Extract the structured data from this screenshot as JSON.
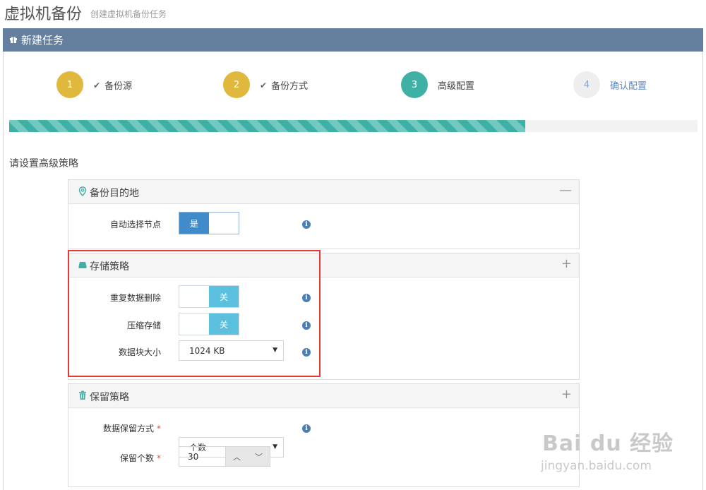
{
  "page": {
    "title": "虚拟机备份",
    "subtitle": "创建虚拟机备份任务"
  },
  "task_header": {
    "title": "新建任务",
    "icon": "gift-icon"
  },
  "steps": [
    {
      "number": "1",
      "label": "备份源",
      "done": true,
      "color": "#e0b83e"
    },
    {
      "number": "2",
      "label": "备份方式",
      "done": true,
      "color": "#e0b83e"
    },
    {
      "number": "3",
      "label": "高级配置",
      "done": false,
      "color": "#3fb0a5"
    },
    {
      "number": "4",
      "label": "确认配置",
      "done": false,
      "color": "#eeeeee"
    }
  ],
  "progress": {
    "percent": 75,
    "color": "#3fb0a5"
  },
  "section_hint": "请设置高级策略",
  "panels": {
    "destination": {
      "title": "备份目的地",
      "icon": "map-marker-icon",
      "toggle": "—",
      "fields": {
        "auto_select_node": {
          "label": "自动选择节点",
          "state": "是"
        }
      }
    },
    "storage": {
      "title": "存储策略",
      "icon": "hdd-icon",
      "toggle": "+",
      "fields": {
        "dedup": {
          "label": "重复数据删除",
          "state": "关"
        },
        "compress": {
          "label": "压缩存储",
          "state": "关"
        },
        "block_size": {
          "label": "数据块大小",
          "value": "1024 KB"
        }
      }
    },
    "retention": {
      "title": "保留策略",
      "icon": "trash-icon",
      "toggle": "+",
      "fields": {
        "mode": {
          "label": "数据保留方式",
          "required": "*",
          "value": "个数"
        },
        "count": {
          "label": "保留个数",
          "required": "*",
          "value": "30"
        }
      }
    }
  },
  "watermark": {
    "brand": "Bai du 经验",
    "url": "jingyan.baidu.com"
  },
  "colors": {
    "header": "#65809f",
    "switch_on": "#428bca",
    "switch_off": "#5bc0de",
    "highlight": "#e53935"
  }
}
